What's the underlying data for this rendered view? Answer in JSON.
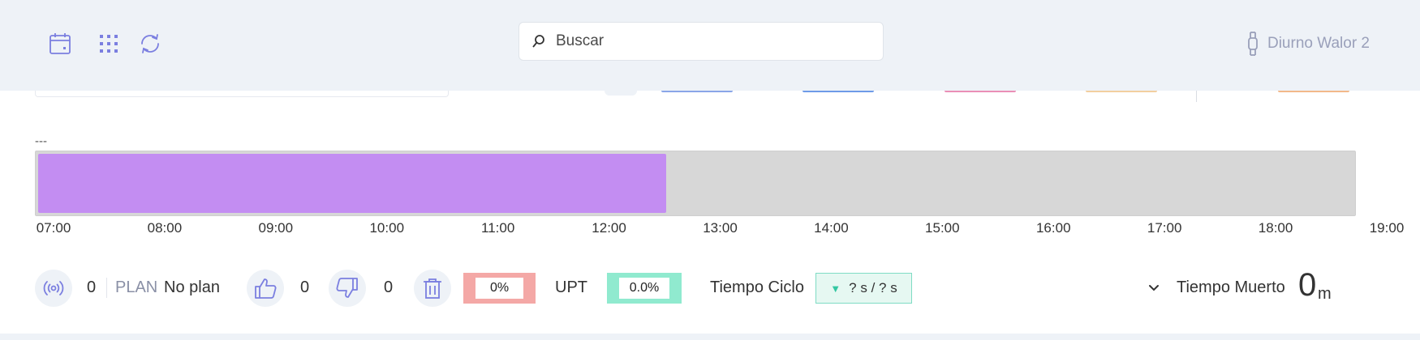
{
  "header": {
    "icons": [
      "calendar-icon",
      "grid-icon",
      "refresh-icon"
    ],
    "search": {
      "placeholder": "Buscar",
      "value": ""
    },
    "user": {
      "name": "Diurno Walor 2",
      "icon": "watch-icon"
    }
  },
  "timeline": {
    "label": "---",
    "start_hour": "07:00",
    "end_hour": "19:00",
    "progress_fraction": 0.478,
    "fill_color": "#c38df2",
    "track_color": "#d7d7d7",
    "ticks": [
      "07:00",
      "08:00",
      "09:00",
      "10:00",
      "11:00",
      "12:00",
      "13:00",
      "14:00",
      "15:00",
      "16:00",
      "17:00",
      "18:00",
      "19:00"
    ]
  },
  "stats": {
    "signal_count": "0",
    "plan_label": "PLAN",
    "plan_value": "No plan",
    "good_count": "0",
    "bad_count": "0",
    "scrap_percent": "0%",
    "upt_label": "UPT",
    "upt_value": "0.0%",
    "cycle_label": "Tiempo Ciclo",
    "cycle_value": "? s / ? s",
    "dead_label": "Tiempo Muerto",
    "dead_value": "0",
    "dead_unit": "m"
  },
  "colors": {
    "accent": "#7b7fe0",
    "scrap": "#f4a8a6",
    "upt": "#90eacf",
    "cycle_border": "#7fdcc4"
  }
}
